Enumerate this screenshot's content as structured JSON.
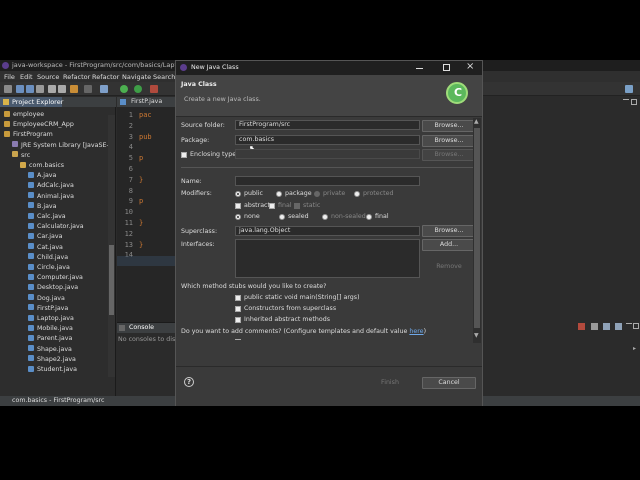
{
  "window": {
    "title": "java-workspace - FirstProgram/src/com/basics/Laptop.java"
  },
  "menu": [
    "File",
    "Edit",
    "Source",
    "Refactor",
    "Refactor",
    "Navigate",
    "Search"
  ],
  "explorer": {
    "tab": "Project Explorer",
    "items": [
      {
        "label": "employee",
        "indent": 0,
        "icon": "project"
      },
      {
        "label": "EmployeeCRM_App",
        "indent": 0,
        "icon": "project"
      },
      {
        "label": "FirstProgram",
        "indent": 0,
        "icon": "project"
      },
      {
        "label": "JRE System Library [JavaSE-1",
        "indent": 1,
        "icon": "library"
      },
      {
        "label": "src",
        "indent": 1,
        "icon": "folder"
      },
      {
        "label": "com.basics",
        "indent": 2,
        "icon": "package"
      },
      {
        "label": "A.java",
        "indent": 3,
        "icon": "java"
      },
      {
        "label": "AdCalc.java",
        "indent": 3,
        "icon": "java"
      },
      {
        "label": "Animal.java",
        "indent": 3,
        "icon": "java"
      },
      {
        "label": "B.java",
        "indent": 3,
        "icon": "java"
      },
      {
        "label": "Calc.java",
        "indent": 3,
        "icon": "java"
      },
      {
        "label": "Calculator.java",
        "indent": 3,
        "icon": "java"
      },
      {
        "label": "Car.java",
        "indent": 3,
        "icon": "java"
      },
      {
        "label": "Cat.java",
        "indent": 3,
        "icon": "java"
      },
      {
        "label": "Child.java",
        "indent": 3,
        "icon": "java"
      },
      {
        "label": "Circle.java",
        "indent": 3,
        "icon": "java"
      },
      {
        "label": "Computer.java",
        "indent": 3,
        "icon": "java"
      },
      {
        "label": "Desktop.java",
        "indent": 3,
        "icon": "java"
      },
      {
        "label": "Dog.java",
        "indent": 3,
        "icon": "java"
      },
      {
        "label": "FirstP.java",
        "indent": 3,
        "icon": "java"
      },
      {
        "label": "Laptop.java",
        "indent": 3,
        "icon": "java"
      },
      {
        "label": "Mobile.java",
        "indent": 3,
        "icon": "java"
      },
      {
        "label": "Parent.java",
        "indent": 3,
        "icon": "java"
      },
      {
        "label": "Shape.java",
        "indent": 3,
        "icon": "java"
      },
      {
        "label": "Shape2.java",
        "indent": 3,
        "icon": "java"
      },
      {
        "label": "Student.java",
        "indent": 3,
        "icon": "java"
      }
    ]
  },
  "editor": {
    "tab": "FirstP.java",
    "lines": [
      {
        "n": "1",
        "code": "pac"
      },
      {
        "n": "2",
        "code": ""
      },
      {
        "n": "3",
        "code": "pub"
      },
      {
        "n": "4",
        "code": ""
      },
      {
        "n": "5",
        "code": "  p"
      },
      {
        "n": "6",
        "code": ""
      },
      {
        "n": "7",
        "code": "  }"
      },
      {
        "n": "8",
        "code": ""
      },
      {
        "n": "9",
        "code": "  p"
      },
      {
        "n": "10",
        "code": ""
      },
      {
        "n": "11",
        "code": "  }"
      },
      {
        "n": "12",
        "code": ""
      },
      {
        "n": "13",
        "code": "}"
      },
      {
        "n": "14",
        "code": ""
      }
    ]
  },
  "console": {
    "tab": "Console",
    "message": "No consoles to displ"
  },
  "status": {
    "text": "com.basics - FirstProgram/src"
  },
  "dialog": {
    "title": "New Java Class",
    "heading": "Java Class",
    "description": "Create a new Java class.",
    "source_folder_label": "Source folder:",
    "source_folder_value": "FirstProgram/src",
    "package_label": "Package:",
    "package_value": "com.basics",
    "enclosing_label": "Enclosing type:",
    "name_label": "Name:",
    "modifiers_label": "Modifiers:",
    "mod_row1": [
      "public",
      "package",
      "private",
      "protected"
    ],
    "mod_row2": [
      "abstract",
      "final",
      "static"
    ],
    "mod_row3": [
      "none",
      "sealed",
      "non-sealed",
      "final"
    ],
    "superclass_label": "Superclass:",
    "superclass_value": "java.lang.Object",
    "interfaces_label": "Interfaces:",
    "browse": "Browse...",
    "add": "Add...",
    "remove": "Remove",
    "stubs_question": "Which method stubs would you like to create?",
    "stubs": [
      "public static void main(String[] args)",
      "Constructors from superclass",
      "Inherited abstract methods"
    ],
    "comments_question": "Do you want to add comments? (Configure templates and default value ",
    "comments_link": "here",
    "comments_tail": ")",
    "finish": "Finish",
    "cancel": "Cancel",
    "help": "?"
  }
}
